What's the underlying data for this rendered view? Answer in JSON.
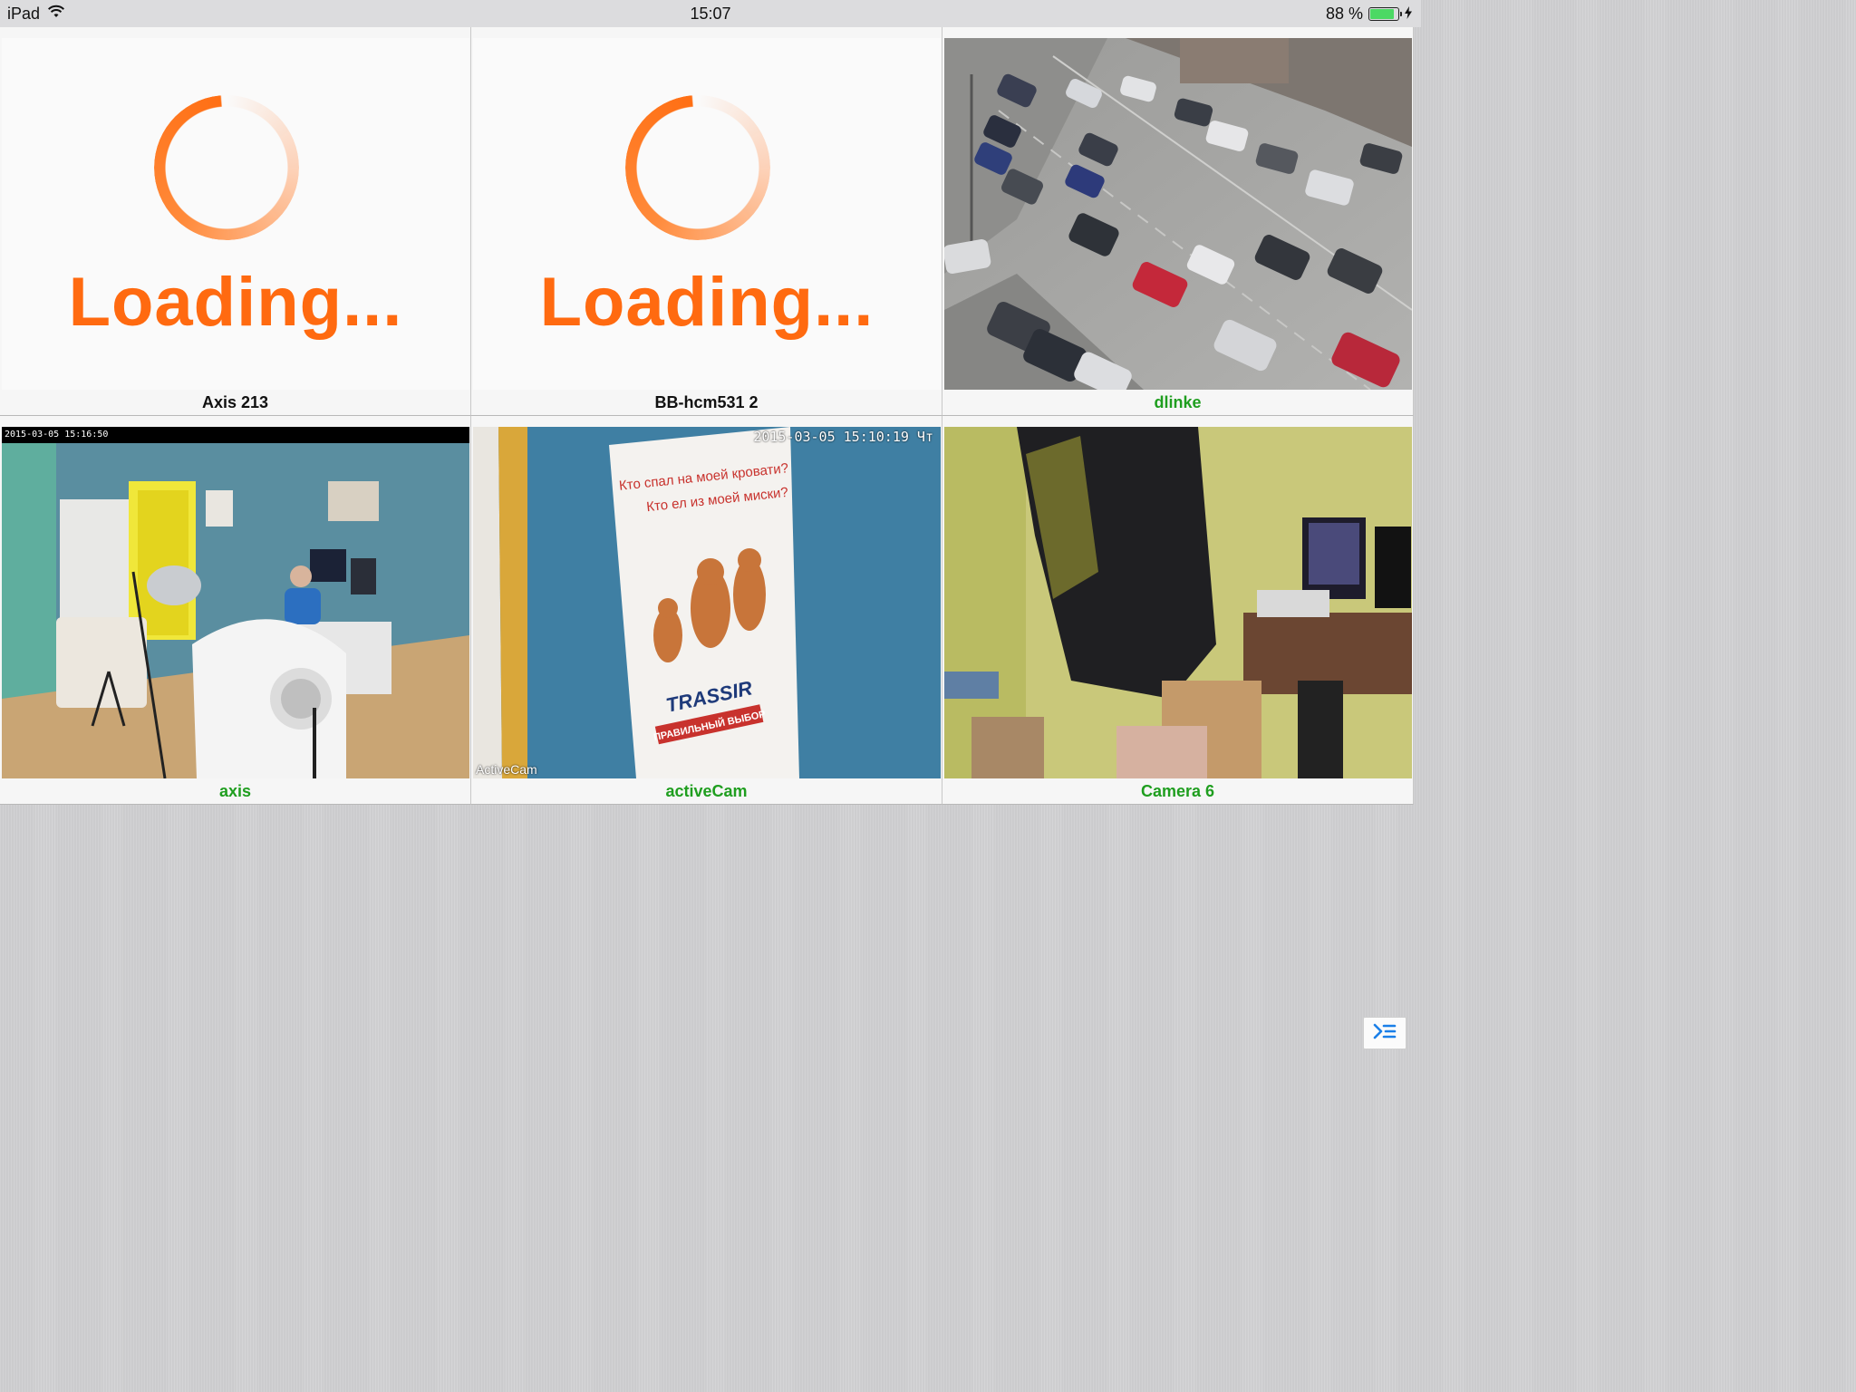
{
  "status_bar": {
    "device": "iPad",
    "time": "15:07",
    "battery_text": "88 %",
    "battery_level": 0.88,
    "wifi_icon": "wifi-icon",
    "charging_icon": "charging-bolt-icon"
  },
  "cameras": [
    {
      "name": "Axis 213",
      "state": "loading",
      "loading_text": "Loading...",
      "label_color": "#111111"
    },
    {
      "name": "BB-hcm531 2",
      "state": "loading",
      "loading_text": "Loading...",
      "label_color": "#111111"
    },
    {
      "name": "dlinke",
      "state": "live",
      "scene": "street-traffic",
      "label_color": "#1f9e1f"
    },
    {
      "name": "axis",
      "state": "live",
      "scene": "office-room",
      "osd_timestamp": "2015-03-05 15:16:50",
      "label_color": "#1f9e1f"
    },
    {
      "name": "activeCam",
      "state": "live",
      "scene": "poster-wall",
      "osd_timestamp": "2015-03-05 15:10:19 Чт",
      "brand": "ActiveCam",
      "label_color": "#1f9e1f",
      "poster": {
        "line1": "Кто спал на моей кровати?",
        "line2": "Кто ел из моей миски?",
        "logo": "TRASSIR",
        "tagline": "ПРАВИЛЬНЫЙ ВЫБОР"
      }
    },
    {
      "name": "Camera 6",
      "state": "live",
      "scene": "storage-room",
      "label_color": "#1f9e1f"
    }
  ],
  "menu_button": {
    "icon": "menu-indent-icon",
    "accent": "#1a7fe8"
  },
  "colors": {
    "loading_orange": "#ff6a10",
    "online_green": "#1f9e1f"
  }
}
